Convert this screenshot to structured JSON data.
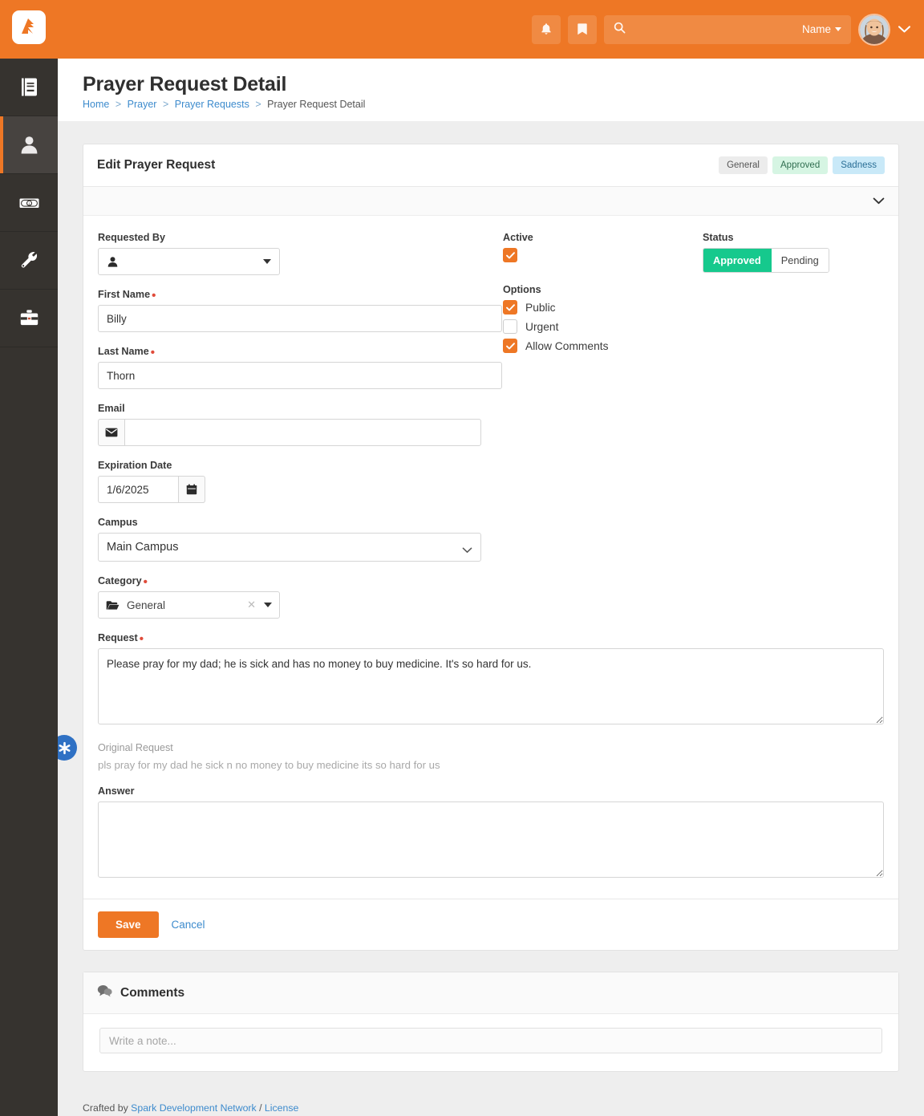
{
  "topbar": {
    "brand_color": "#ee7725",
    "logo_name": "rock-rms-logo",
    "notifications_icon": "bell-icon",
    "bookmarks_icon": "bookmark-icon",
    "search_placeholder": "",
    "search_value": "",
    "search_scope_label": "Name",
    "user_avatar_alt": "User avatar"
  },
  "sidebar": {
    "items": [
      {
        "name": "cms",
        "icon": "book-icon",
        "active": false
      },
      {
        "name": "people",
        "icon": "person-icon",
        "active": true
      },
      {
        "name": "finance",
        "icon": "money-bill-icon",
        "active": false
      },
      {
        "name": "tools",
        "icon": "wrench-icon",
        "active": false
      },
      {
        "name": "admin",
        "icon": "toolbox-icon",
        "active": false
      }
    ]
  },
  "page": {
    "title": "Prayer Request Detail",
    "breadcrumb": [
      {
        "label": "Home",
        "link": true
      },
      {
        "label": "Prayer",
        "link": true
      },
      {
        "label": "Prayer Requests",
        "link": true
      },
      {
        "label": "Prayer Request Detail",
        "link": false
      }
    ],
    "breadcrumb_separator": ">"
  },
  "panel": {
    "title": "Edit Prayer Request",
    "badges": [
      {
        "label": "General",
        "bg": "#ececec",
        "fg": "#555555"
      },
      {
        "label": "Approved",
        "bg": "#d6f5e3",
        "fg": "#2f6d4f"
      },
      {
        "label": "Sadness",
        "bg": "#c9e9f8",
        "fg": "#2b6f96"
      }
    ],
    "collapse_icon": "chevron-down-icon"
  },
  "form": {
    "requested_by": {
      "label": "Requested By",
      "value": "",
      "icon": "person-icon",
      "dropdown_icon": "caret-down-icon"
    },
    "first_name": {
      "label": "First Name",
      "required": true,
      "value": "Billy",
      "placeholder": ""
    },
    "last_name": {
      "label": "Last Name",
      "required": true,
      "value": "Thorn",
      "placeholder": ""
    },
    "email": {
      "label": "Email",
      "required": false,
      "value": "",
      "placeholder": "",
      "addon_icon": "envelope-icon"
    },
    "expiration_date": {
      "label": "Expiration Date",
      "value": "1/6/2025",
      "addon_icon": "calendar-icon"
    },
    "campus": {
      "label": "Campus",
      "selected": "Main Campus",
      "options": [
        "Main Campus"
      ],
      "chevron_icon": "chevron-down-icon"
    },
    "category": {
      "label": "Category",
      "required": true,
      "value": "General",
      "folder_icon": "folder-open-icon",
      "clear_icon": "clear-x-icon",
      "dropdown_icon": "caret-down-icon"
    },
    "request": {
      "label": "Request",
      "required": true,
      "value": "Please pray for my dad; he is sick and has no money to buy medicine. It's so hard for us.",
      "placeholder": ""
    },
    "original_request": {
      "badge_icon": "asterisk-icon",
      "badge_color": "#2f71c4",
      "label": "Original Request",
      "text": "pls pray for my dad he sick n no money to buy medicine its so hard for us"
    },
    "answer": {
      "label": "Answer",
      "value": "",
      "placeholder": ""
    },
    "active": {
      "label": "Active",
      "checked": true
    },
    "options": {
      "label": "Options",
      "items": [
        {
          "label": "Public",
          "checked": true
        },
        {
          "label": "Urgent",
          "checked": false
        },
        {
          "label": "Allow Comments",
          "checked": true
        }
      ]
    },
    "status": {
      "label": "Status",
      "selected": "Approved",
      "options": [
        "Approved",
        "Pending"
      ],
      "selected_color": "#16c98d"
    }
  },
  "actions": {
    "save_label": "Save",
    "cancel_label": "Cancel"
  },
  "comments": {
    "icon": "comments-icon",
    "title": "Comments",
    "note_placeholder": "Write a note...",
    "note_value": ""
  },
  "footer": {
    "prefix": "Crafted by ",
    "org_label": "Spark Development Network",
    "divider": " / ",
    "license_label": "License"
  }
}
